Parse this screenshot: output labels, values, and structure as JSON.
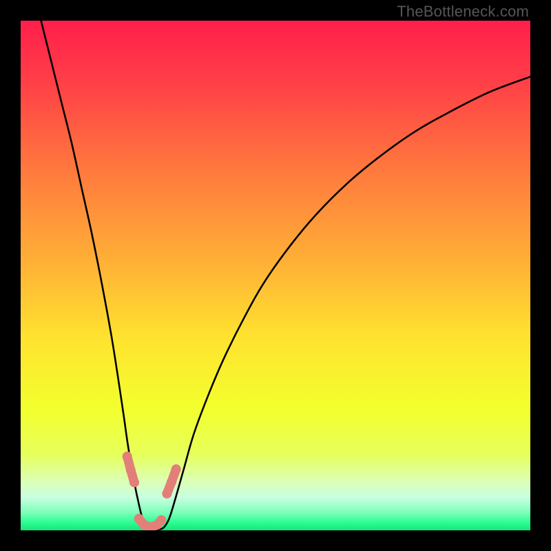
{
  "watermark": "TheBottleneck.com",
  "chart_data": {
    "type": "line",
    "title": "",
    "xlabel": "",
    "ylabel": "",
    "xlim": [
      0,
      100
    ],
    "ylim": [
      0,
      100
    ],
    "gradient_stops": [
      {
        "offset": 0.0,
        "color": "#ff1f4b"
      },
      {
        "offset": 0.12,
        "color": "#ff3f47"
      },
      {
        "offset": 0.3,
        "color": "#ff7b3d"
      },
      {
        "offset": 0.48,
        "color": "#ffb236"
      },
      {
        "offset": 0.62,
        "color": "#ffe22f"
      },
      {
        "offset": 0.76,
        "color": "#f3ff2d"
      },
      {
        "offset": 0.85,
        "color": "#e7ff5a"
      },
      {
        "offset": 0.9,
        "color": "#ddffb0"
      },
      {
        "offset": 0.935,
        "color": "#c9ffe0"
      },
      {
        "offset": 0.965,
        "color": "#7dffba"
      },
      {
        "offset": 0.985,
        "color": "#2bfd91"
      },
      {
        "offset": 1.0,
        "color": "#19e37b"
      }
    ],
    "curve": {
      "comment": "V-shaped bottleneck curve. x in [0,100], y is severity (100=top/red, 0=bottom/green). Minimum plateau ~0 near x≈24–28.",
      "x": [
        4,
        6,
        8,
        10,
        12,
        14,
        16,
        18,
        20,
        21,
        22,
        23,
        24,
        25,
        26,
        27,
        28,
        29,
        30,
        32,
        34,
        37,
        40,
        44,
        48,
        53,
        58,
        64,
        70,
        77,
        84,
        92,
        100
      ],
      "y": [
        100,
        92,
        84,
        76,
        67,
        58,
        48,
        37,
        24,
        17,
        11,
        6,
        2,
        0.5,
        0.2,
        0.2,
        0.5,
        2,
        5,
        12,
        19,
        27,
        34,
        42,
        49,
        56,
        62,
        68,
        73,
        78,
        82,
        86,
        89
      ]
    },
    "markers": {
      "comment": "Salmon-colored connected dots near the trough on both arms.",
      "color": "#e27f78",
      "left_cluster": {
        "x": [
          20.9,
          21.6,
          22.3
        ],
        "y": [
          14.5,
          11.8,
          9.4
        ]
      },
      "right_cluster": {
        "x": [
          28.7,
          29.6,
          30.5
        ],
        "y": [
          7.2,
          9.5,
          12.0
        ]
      },
      "bottom_cluster": {
        "x": [
          23.2,
          24.1,
          25.0,
          25.9,
          26.8,
          27.6
        ],
        "y": [
          2.3,
          1.2,
          0.7,
          0.7,
          1.1,
          2.0
        ]
      }
    }
  }
}
